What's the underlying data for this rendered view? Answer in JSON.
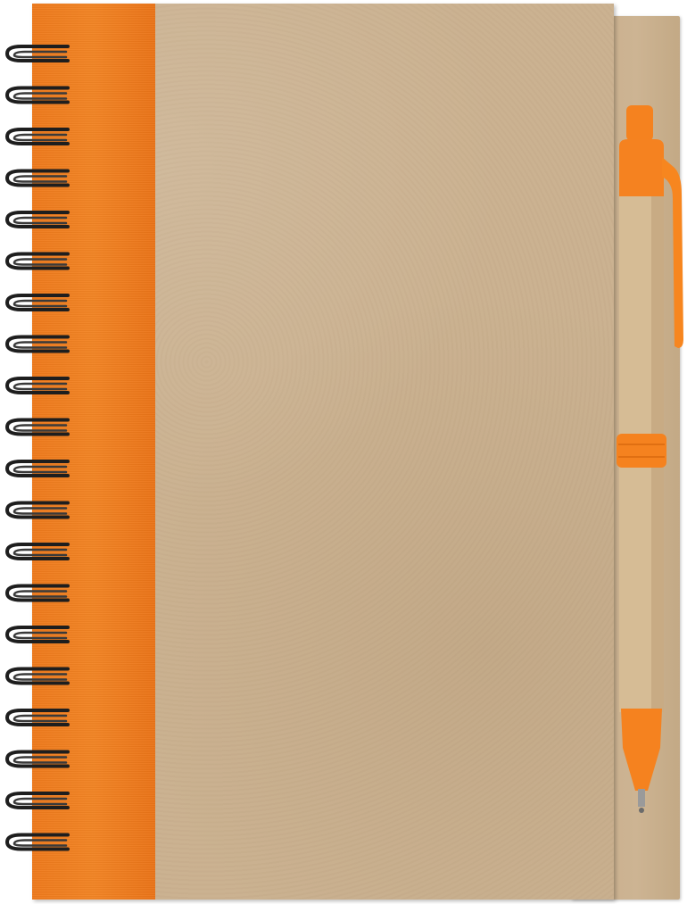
{
  "image": {
    "subject": "spiral-notebook-with-pen",
    "colors": {
      "kraft": "#cbb291",
      "kraft_dark": "#c3a985",
      "spine": "#f28424",
      "pen_accent": "#f5821f",
      "wire": "#1e1e1e"
    }
  },
  "spiral": {
    "coil_count": 20
  }
}
